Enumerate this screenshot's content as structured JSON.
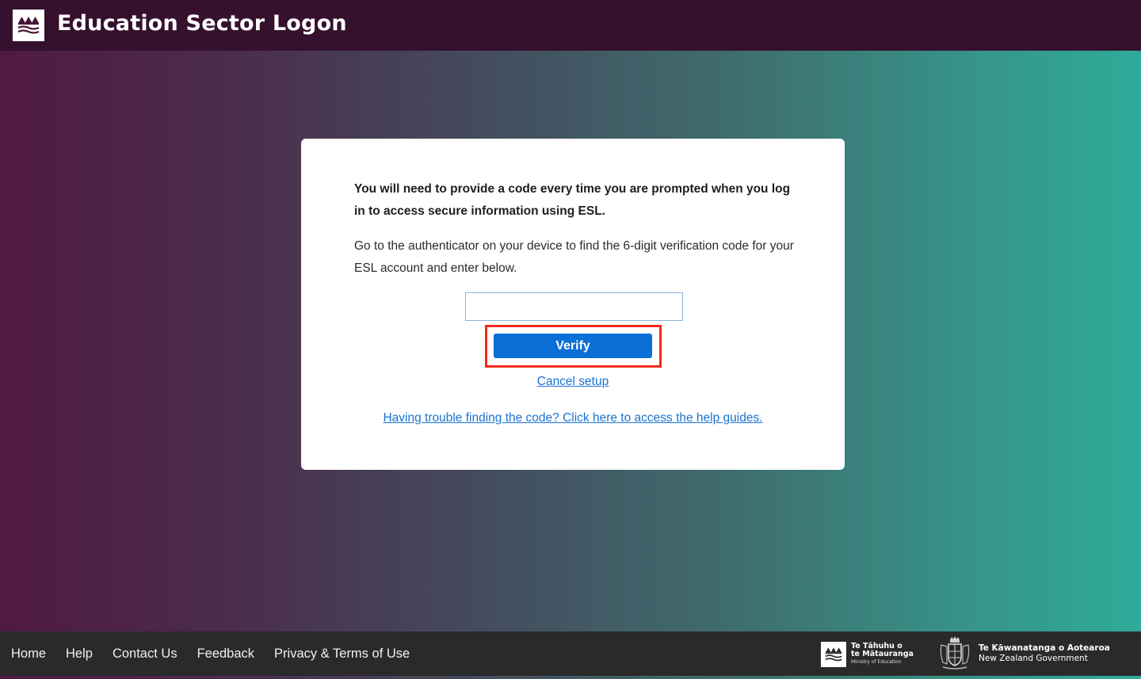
{
  "header": {
    "title": "Education Sector Logon",
    "logo_icon": "mountains-waves-icon"
  },
  "card": {
    "lead": "You will need to provide a code every time you are prompted when you log in to access secure information using ESL.",
    "instructions": "Go to the authenticator on your device to find the 6-digit verification code for your ESL account and enter below.",
    "code_input": {
      "value": "",
      "placeholder": ""
    },
    "verify_label": "Verify",
    "cancel_label": "Cancel setup",
    "help_label": "Having trouble finding the code? Click here to access the help guides."
  },
  "footer": {
    "links": [
      {
        "label": "Home"
      },
      {
        "label": "Help"
      },
      {
        "label": "Contact Us"
      },
      {
        "label": "Feedback"
      },
      {
        "label": "Privacy & Terms of Use"
      }
    ],
    "ministry": {
      "line1": "Te Tāhuhu o",
      "line2": "te Mātauranga",
      "line3": "Ministry of Education"
    },
    "government": {
      "line1": "Te Kāwanatanga o Aotearoa",
      "line2": "New Zealand Government"
    }
  },
  "colors": {
    "header_bg": "#35112d",
    "footer_bg": "#2a2a2a",
    "primary_button": "#0a6fd6",
    "link": "#1a73d1",
    "highlight": "#f5291a",
    "gradient_start": "#501a42",
    "gradient_end": "#2fab99"
  }
}
